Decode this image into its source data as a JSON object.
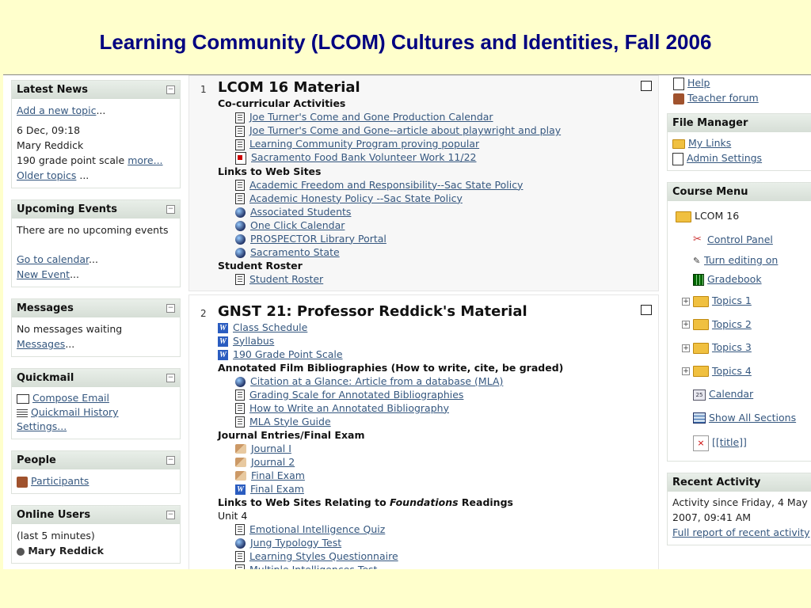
{
  "slide_title": "Learning Community (LCOM)  Cultures and Identities, Fall 2006",
  "left": {
    "latest_news": {
      "title": "Latest News",
      "add_link": "Add a new topic",
      "add_suffix": "...",
      "date": "6 Dec, 09:18",
      "author": "Mary Reddick",
      "item_text": "190 grade point scale",
      "more_link": "more...",
      "older_link": "Older topics",
      "older_suffix": " ..."
    },
    "upcoming_events": {
      "title": "Upcoming Events",
      "text": "There are no upcoming events",
      "calendar_link": "Go to calendar",
      "calendar_suffix": "...",
      "new_event_link": "New Event",
      "new_event_suffix": "..."
    },
    "messages": {
      "title": "Messages",
      "text": "No messages waiting",
      "link": "Messages",
      "suffix": "..."
    },
    "quickmail": {
      "title": "Quickmail",
      "compose": "Compose Email",
      "history": "Quickmail History",
      "settings": "Settings..."
    },
    "people": {
      "title": "People",
      "participants": "Participants"
    },
    "online_users": {
      "title": "Online Users",
      "text": "(last 5 minutes)",
      "user": "Mary Reddick"
    },
    "toggle_symbol": "−"
  },
  "sections": [
    {
      "num": "1",
      "title": "LCOM 16 Material",
      "rows": [
        {
          "kind": "label",
          "text": "Co-curricular Activities"
        },
        {
          "kind": "link",
          "icon": "doc",
          "text": "Joe Turner's Come and Gone Production Calendar"
        },
        {
          "kind": "link",
          "icon": "doc",
          "text": "Joe Turner's Come and Gone--article about playwright and play"
        },
        {
          "kind": "link",
          "icon": "doc",
          "text": "Learning Community Program proving popular"
        },
        {
          "kind": "link",
          "icon": "pdf",
          "text": "Sacramento Food Bank Volunteer Work 11/22"
        },
        {
          "kind": "label",
          "text": "Links to Web Sites"
        },
        {
          "kind": "link",
          "icon": "doc",
          "text": "Academic Freedom and Responsibility--Sac State Policy"
        },
        {
          "kind": "link",
          "icon": "doc",
          "text": "Academic Honesty Policy --Sac State Policy"
        },
        {
          "kind": "link",
          "icon": "globe",
          "text": "Associated Students"
        },
        {
          "kind": "link",
          "icon": "globe",
          "text": "One Click Calendar"
        },
        {
          "kind": "link",
          "icon": "globe",
          "text": "PROSPECTOR Library Portal"
        },
        {
          "kind": "link",
          "icon": "globe",
          "text": "Sacramento State"
        },
        {
          "kind": "label",
          "text": "Student Roster"
        },
        {
          "kind": "link",
          "icon": "doc",
          "text": "Student Roster"
        }
      ]
    },
    {
      "num": "2",
      "title": "GNST 21:  Professor Reddick's Material",
      "rows": [
        {
          "kind": "link0",
          "icon": "word",
          "text": "Class Schedule"
        },
        {
          "kind": "link0",
          "icon": "word",
          "text": "Syllabus"
        },
        {
          "kind": "link0",
          "icon": "word",
          "text": "190 Grade Point Scale"
        },
        {
          "kind": "label",
          "text": "Annotated Film Bibliographies (How to write, cite, be graded)"
        },
        {
          "kind": "link",
          "icon": "globe",
          "text": "Citation at a Glance: Article from a database (MLA)"
        },
        {
          "kind": "link",
          "icon": "doc",
          "text": "Grading Scale for Annotated Bibliographies"
        },
        {
          "kind": "link",
          "icon": "doc",
          "text": "How to Write an Annotated Bibliography"
        },
        {
          "kind": "link",
          "icon": "doc",
          "text": "MLA Style Guide"
        },
        {
          "kind": "label",
          "text": "Journal Entries/Final Exam"
        },
        {
          "kind": "link",
          "icon": "quiz",
          "text": "Journal I"
        },
        {
          "kind": "link",
          "icon": "quiz",
          "text": "Journal 2"
        },
        {
          "kind": "link",
          "icon": "quiz",
          "text": "Final Exam"
        },
        {
          "kind": "link",
          "icon": "word",
          "text": "Final Exam"
        },
        {
          "kind": "label_it",
          "text_a": "Links to Web Sites Relating to ",
          "text_i": "Foundations",
          "text_b": " Readings"
        },
        {
          "kind": "plain",
          "text": "Unit 4"
        },
        {
          "kind": "link",
          "icon": "doc",
          "text": "Emotional Intelligence Quiz"
        },
        {
          "kind": "link",
          "icon": "globe",
          "text": "Jung Typology Test"
        },
        {
          "kind": "link",
          "icon": "doc",
          "text": "Learning Styles Questionnaire"
        },
        {
          "kind": "link",
          "icon": "doc",
          "text": "Multiple Intelligences Test"
        }
      ]
    }
  ],
  "right": {
    "top_links": {
      "help": "Help",
      "teacher_forum": "Teacher forum"
    },
    "file_manager": {
      "title": "File Manager",
      "my_links": "My Links",
      "admin_settings": "Admin Settings"
    },
    "course_menu": {
      "title": "Course Menu",
      "course": "LCOM 16",
      "control_panel": "Control Panel",
      "turn_editing": "Turn editing on",
      "gradebook": "Gradebook",
      "topics": [
        "Topics 1",
        "Topics 2",
        "Topics 3",
        "Topics 4"
      ],
      "calendar": "Calendar",
      "show_all": "Show All Sections",
      "title_link": "[[title]]",
      "calendar_day": "25"
    },
    "recent_activity": {
      "title": "Recent Activity",
      "text": "Activity since Friday, 4 May 2007, 09:41 AM",
      "link": "Full report of recent activity"
    }
  }
}
